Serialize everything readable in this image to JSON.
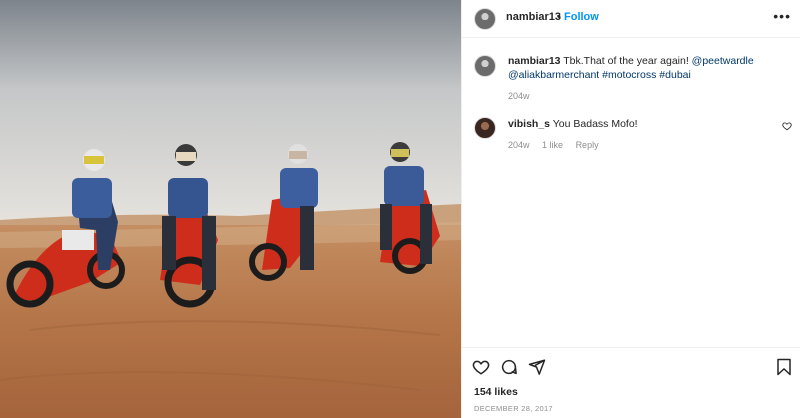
{
  "post": {
    "username": "nambiar13",
    "separator": "•",
    "follow_label": "Follow",
    "more_label": "•••",
    "caption": {
      "username": "nambiar13",
      "text": " Tbk.That of the year again! ",
      "mentions_line1": "@peetwardle",
      "mentions_line2": "@aliakbarmerchant #motocross #dubai",
      "time": "204w"
    },
    "comments": [
      {
        "username": "vibish_s",
        "text": " You Badass Mofo!",
        "time": "204w",
        "likes": "1 like",
        "reply_label": "Reply"
      }
    ],
    "likes_label": "154 likes",
    "date_label": "DECEMBER 28, 2017"
  },
  "icons": {
    "like": "heart-icon",
    "comment": "comment-icon",
    "share": "share-icon",
    "save": "bookmark-icon",
    "comment_like": "heart-icon"
  },
  "colors": {
    "accent": "#0095f6",
    "link": "#00376b",
    "muted": "#8e8e8e",
    "motorcycle": "#d8311f"
  }
}
